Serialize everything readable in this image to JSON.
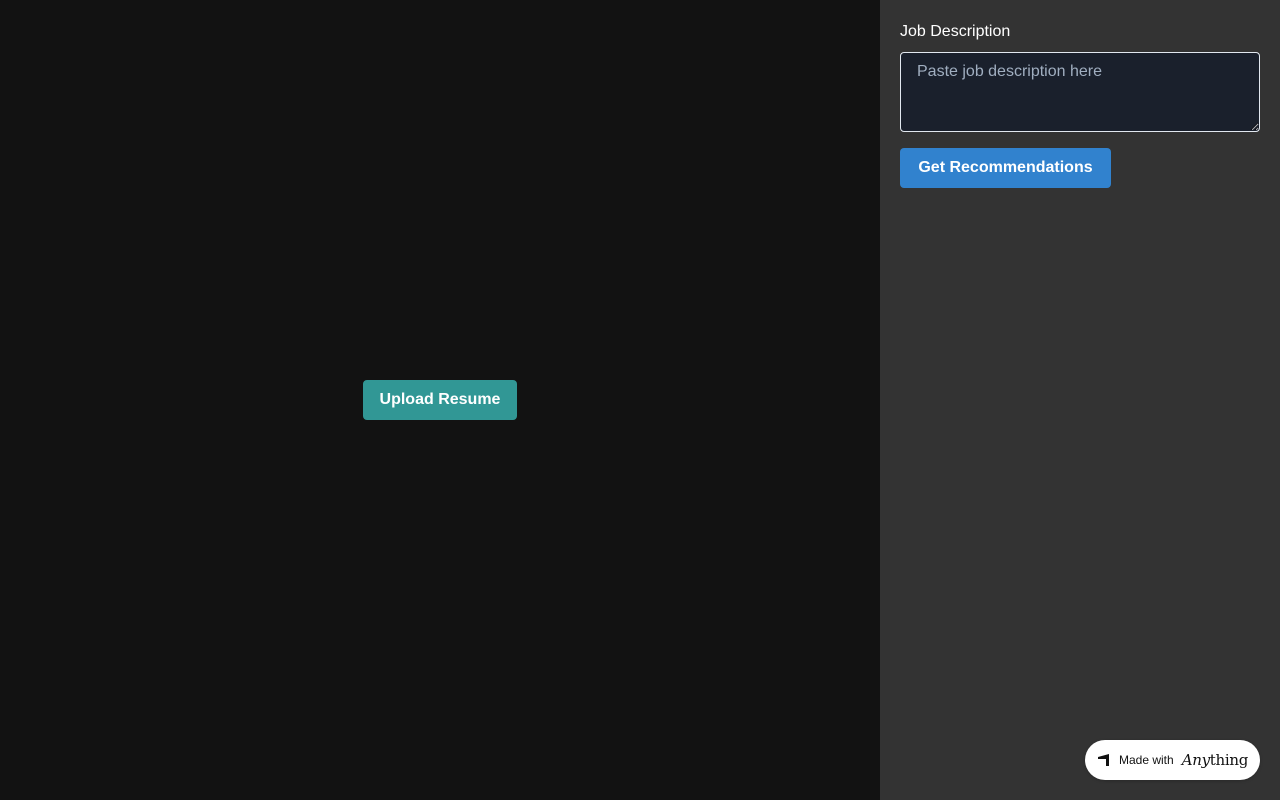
{
  "main": {
    "upload_button_label": "Upload Resume"
  },
  "side_panel": {
    "job_description_label": "Job Description",
    "job_description_placeholder": "Paste job description here",
    "job_description_value": "",
    "recommend_button_label": "Get Recommendations"
  },
  "badge": {
    "made_with": "Made with",
    "brand_prefix": "Any",
    "brand_suffix": "thing",
    "logo_icon": "anything-logo-icon"
  },
  "colors": {
    "main_background": "#121212",
    "panel_background": "#333333",
    "upload_button": "#319795",
    "recommend_button": "#3182ce",
    "textarea_background": "#1a202c"
  }
}
